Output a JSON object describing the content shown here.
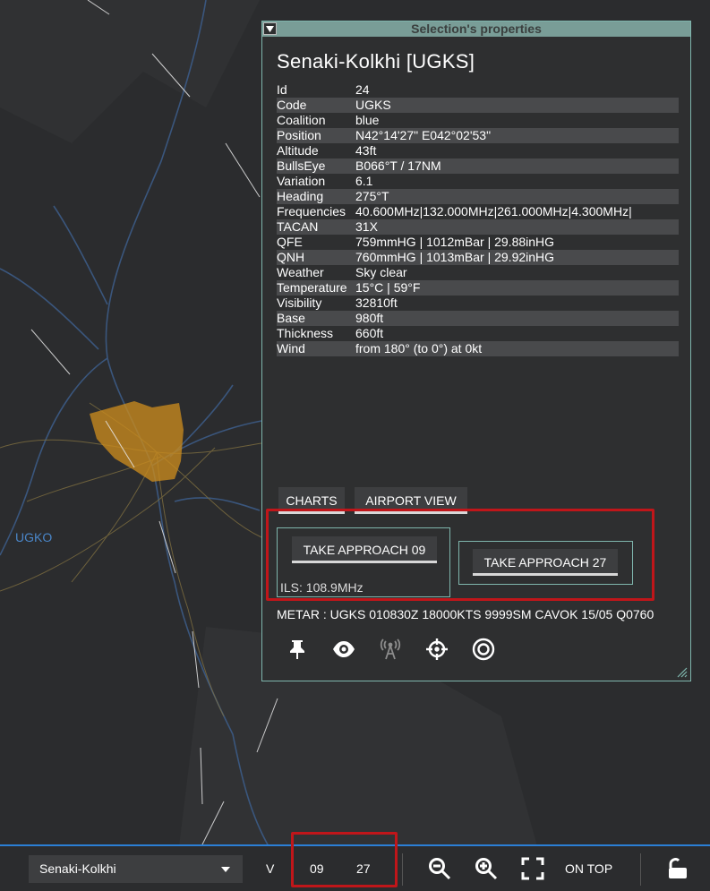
{
  "map": {
    "airbase_label": "UGKO",
    "colors": {
      "background": "#2b2c2e",
      "river": "#3c5b86",
      "road": "#7a6b3f",
      "zone": "#c98a1e"
    }
  },
  "props_window": {
    "title": "Selection's properties",
    "airport_name": "Senaki-Kolkhi [UGKS]",
    "properties": [
      {
        "key": "Id",
        "value": "24"
      },
      {
        "key": "Code",
        "value": "UGKS"
      },
      {
        "key": "Coalition",
        "value": "blue"
      },
      {
        "key": "Position",
        "value": "N42°14'27\" E042°02'53\""
      },
      {
        "key": "Altitude",
        "value": "43ft"
      },
      {
        "key": "BullsEye",
        "value": "B066°T / 17NM"
      },
      {
        "key": "Variation",
        "value": "6.1"
      },
      {
        "key": "Heading",
        "value": "275°T"
      },
      {
        "key": "Frequencies",
        "value": "40.600MHz|132.000MHz|261.000MHz|4.300MHz|"
      },
      {
        "key": "TACAN",
        "value": "31X"
      },
      {
        "key": "QFE",
        "value": "759mmHG | 1012mBar | 29.88inHG"
      },
      {
        "key": "QNH",
        "value": "760mmHG | 1013mBar | 29.92inHG"
      },
      {
        "key": "Weather",
        "value": "Sky clear"
      },
      {
        "key": "Temperature",
        "value": "15°C | 59°F"
      },
      {
        "key": "Visibility",
        "value": "32810ft"
      },
      {
        "key": "Base",
        "value": "980ft"
      },
      {
        "key": "Thickness",
        "value": "660ft"
      },
      {
        "key": "Wind",
        "value": "from 180° (to 0°) at 0kt"
      }
    ],
    "charts_label": "CHARTS",
    "airport_view_label": "AIRPORT VIEW",
    "approach_09_label": "TAKE APPROACH 09",
    "approach_27_label": "TAKE APPROACH 27",
    "ils_label": "ILS: 108.9MHz",
    "metar": "METAR : UGKS 010830Z 18000KTS 9999SM CAVOK 15/05 Q0760",
    "icons": [
      "pin-icon",
      "eye-icon",
      "radio-tower-icon",
      "crosshair-icon",
      "target-icon"
    ]
  },
  "bottom_bar": {
    "airport_select_value": "Senaki-Kolkhi",
    "v_label": "V",
    "runway_1": "09",
    "runway_2": "27",
    "on_top_label": "ON TOP",
    "accent_color": "#2b7fd6"
  }
}
